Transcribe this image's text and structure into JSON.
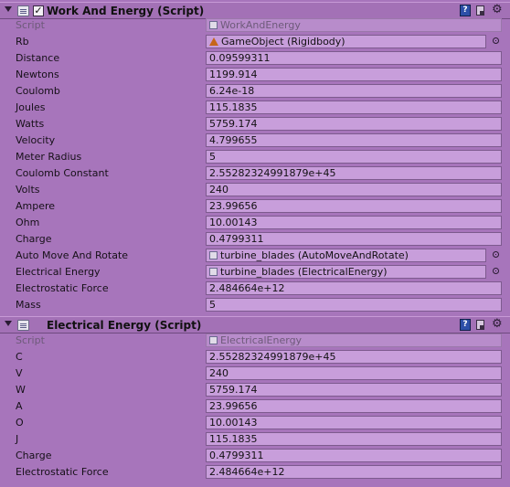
{
  "components": [
    {
      "title": "Work And Energy (Script)",
      "enabled": true,
      "script": {
        "label": "Script",
        "value": "WorkAndEnergy"
      },
      "properties": [
        {
          "label": "Rb",
          "value": "GameObject (Rigidbody)",
          "icon": "gameobject-icon"
        },
        {
          "label": "Distance",
          "value": "0.09599311"
        },
        {
          "label": "Newtons",
          "value": "1199.914"
        },
        {
          "label": "Coulomb",
          "value": "6.24e-18"
        },
        {
          "label": "Joules",
          "value": "115.1835"
        },
        {
          "label": "Watts",
          "value": "5759.174"
        },
        {
          "label": "Velocity",
          "value": "4.799655"
        },
        {
          "label": "Meter Radius",
          "value": "5"
        },
        {
          "label": "Coulomb Constant",
          "value": "2.55282324991879e+45"
        },
        {
          "label": "Volts",
          "value": "240"
        },
        {
          "label": "Ampere",
          "value": "23.99656"
        },
        {
          "label": "Ohm",
          "value": "10.00143"
        },
        {
          "label": "Charge",
          "value": "0.4799311"
        },
        {
          "label": "Auto Move And Rotate",
          "value": "turbine_blades (AutoMoveAndRotate)",
          "icon": "script-icon"
        },
        {
          "label": "Electrical Energy",
          "value": "turbine_blades (ElectricalEnergy)",
          "icon": "script-icon"
        },
        {
          "label": "Electrostatic Force",
          "value": "2.484664e+12"
        },
        {
          "label": "Mass",
          "value": "5"
        }
      ]
    },
    {
      "title": "Electrical Energy (Script)",
      "enabled": null,
      "script": {
        "label": "Script",
        "value": "ElectricalEnergy"
      },
      "properties": [
        {
          "label": "C",
          "value": "2.55282324991879e+45"
        },
        {
          "label": "V",
          "value": "240"
        },
        {
          "label": "W",
          "value": "5759.174"
        },
        {
          "label": "A",
          "value": "23.99656"
        },
        {
          "label": "O",
          "value": "10.00143"
        },
        {
          "label": "J",
          "value": "115.1835"
        },
        {
          "label": "Charge",
          "value": "0.4799311"
        },
        {
          "label": "Electrostatic Force",
          "value": "2.484664e+12"
        }
      ]
    }
  ],
  "colors": {
    "background": "#a775bb",
    "field": "#c89edb",
    "header": "#a371b6"
  }
}
